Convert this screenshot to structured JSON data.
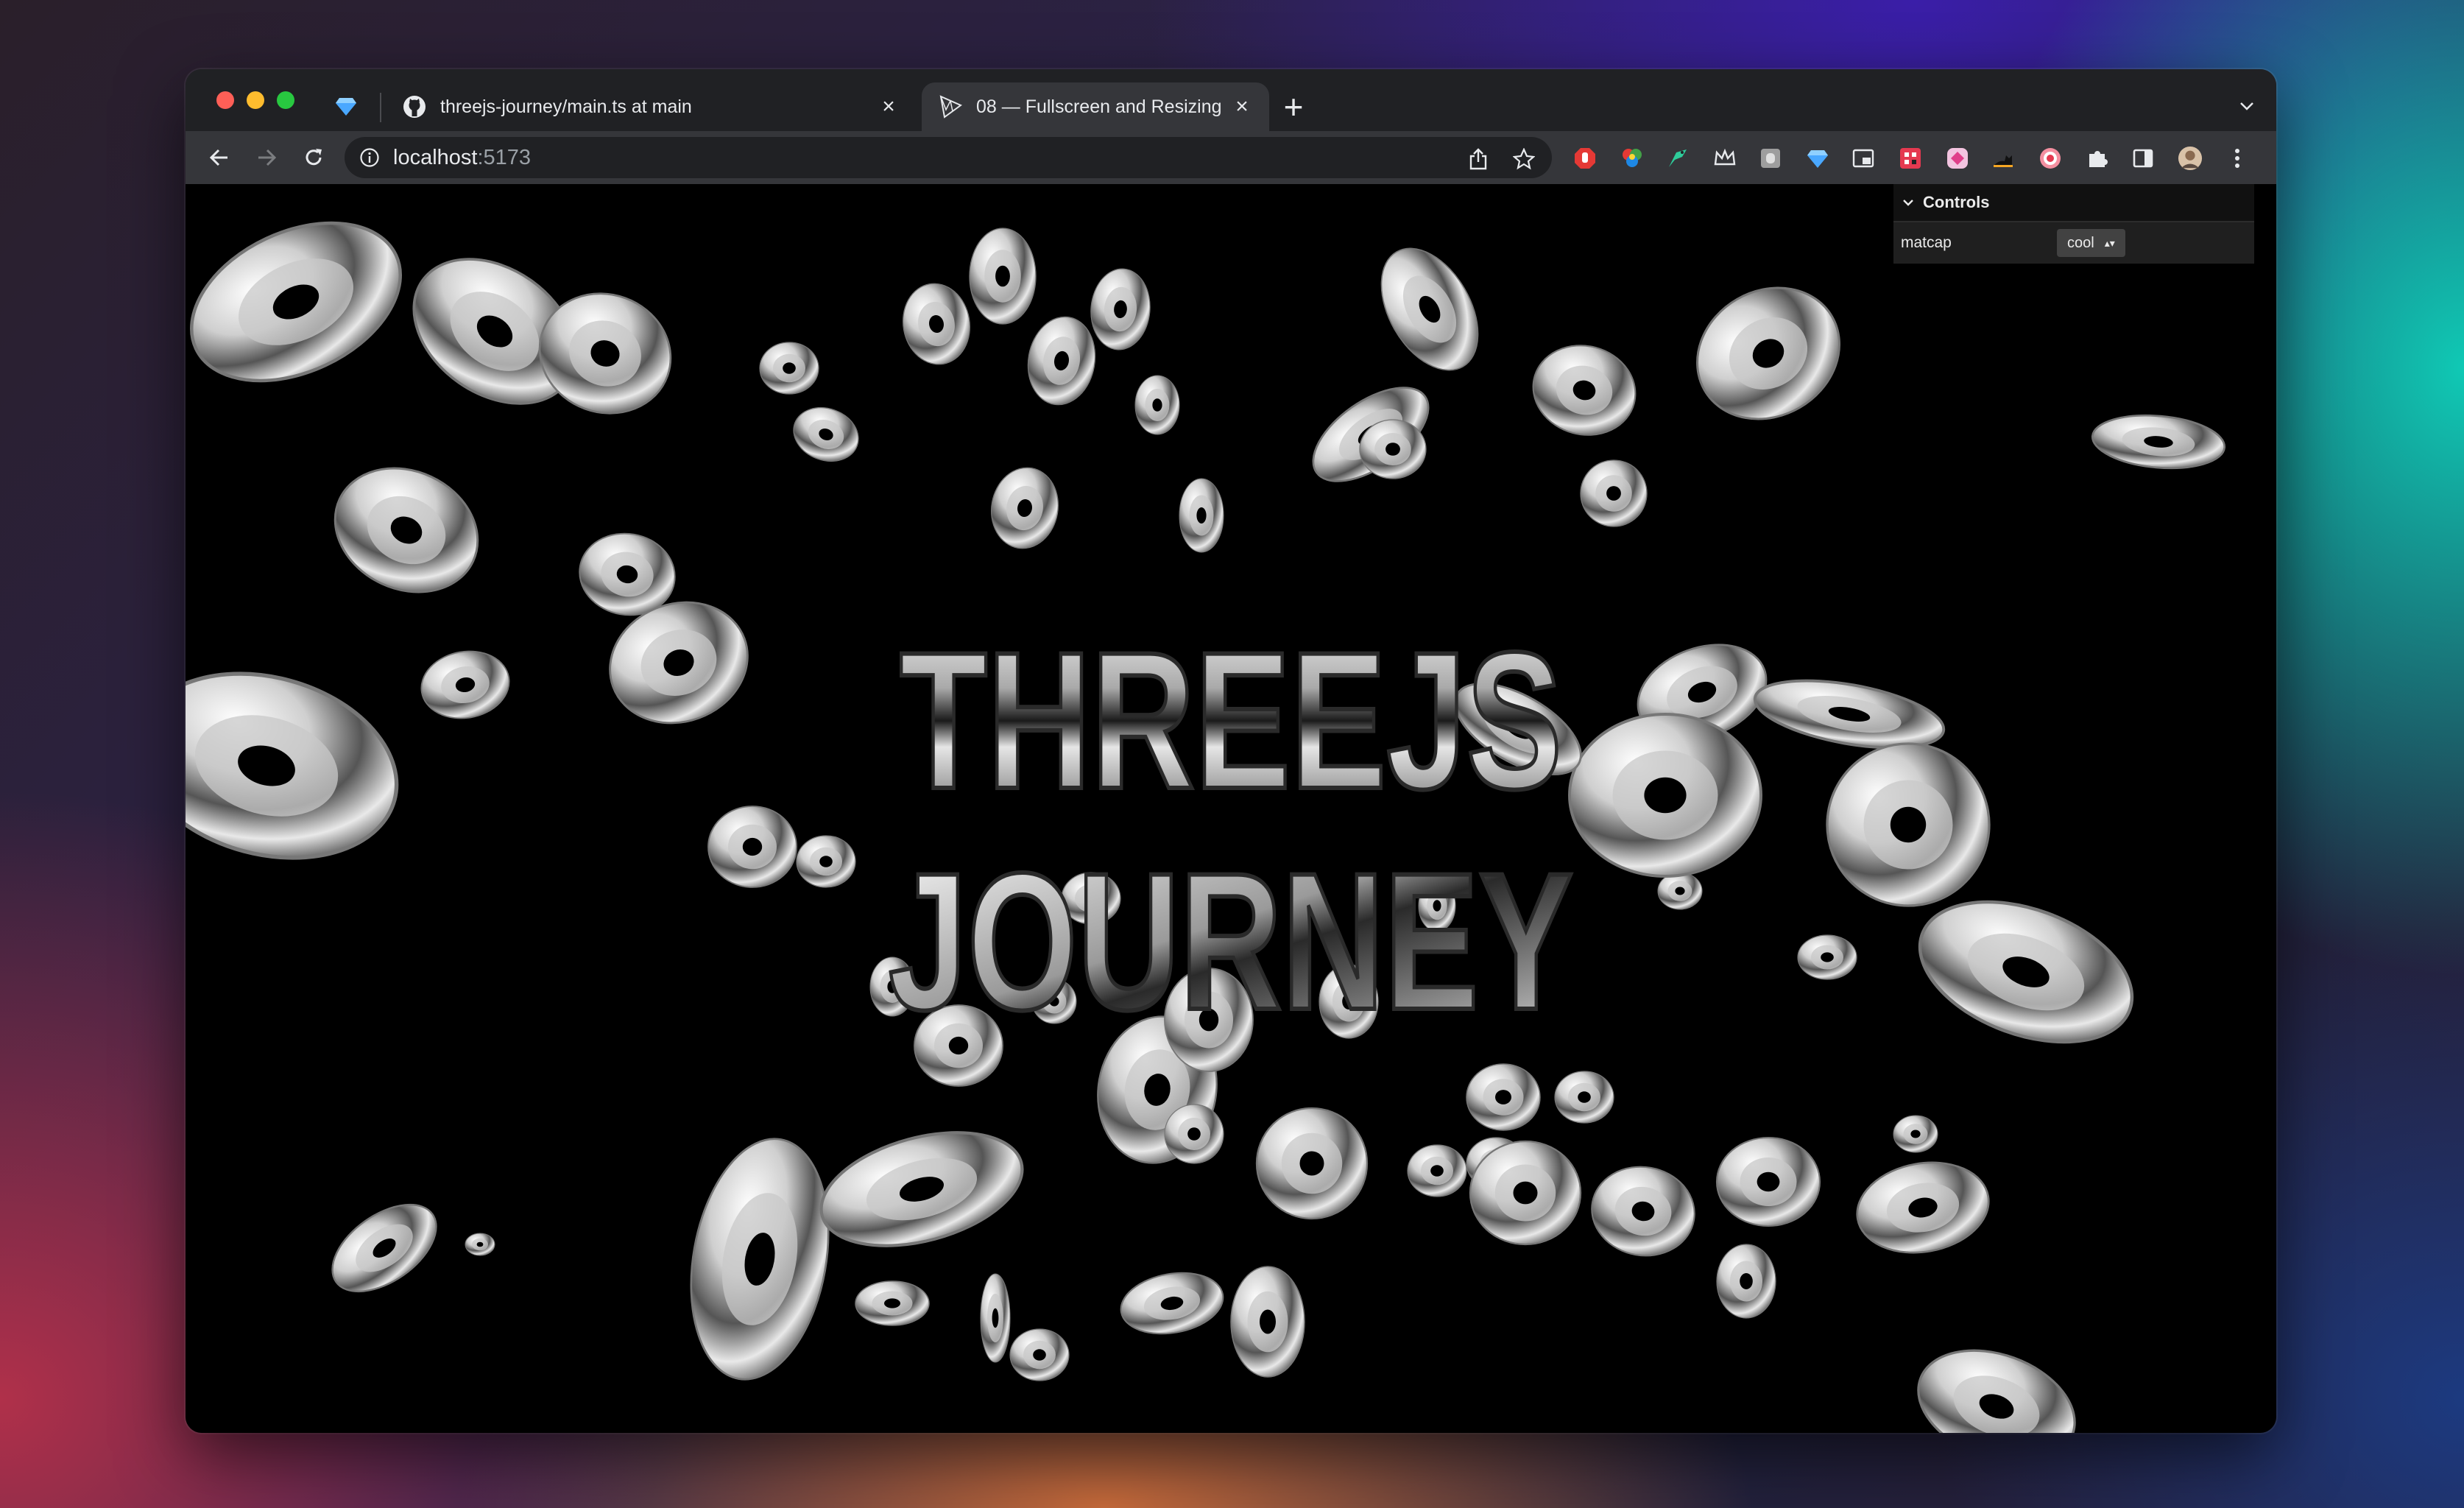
{
  "browser": {
    "tabs": [
      {
        "title": "threejs-journey/main.ts at main",
        "favicon": "github-icon",
        "active": false
      },
      {
        "title": "08 — Fullscreen and Resizing",
        "favicon": "threejs-icon",
        "active": true
      }
    ],
    "pinned_tab_icon": "diamond-icon",
    "new_tab_label": "+",
    "close_label": "×"
  },
  "toolbar": {
    "url_host": "localhost",
    "url_port": ":5173",
    "extensions": [
      "adblock-icon",
      "color-wheel-icon",
      "bird-icon",
      "crown-icon",
      "ghost-icon",
      "diamond-icon",
      "picture-in-picture-icon",
      "grid-icon",
      "tag-icon",
      "cat-icon",
      "target-icon",
      "puzzle-icon",
      "side-panel-icon"
    ],
    "profile_icon": "avatar"
  },
  "scene": {
    "title_line1": "THREEJS",
    "title_line2": "JOURNEY",
    "background": "#000000"
  },
  "gui": {
    "title": "Controls",
    "rows": [
      {
        "label": "matcap",
        "value": "cool"
      }
    ]
  }
}
